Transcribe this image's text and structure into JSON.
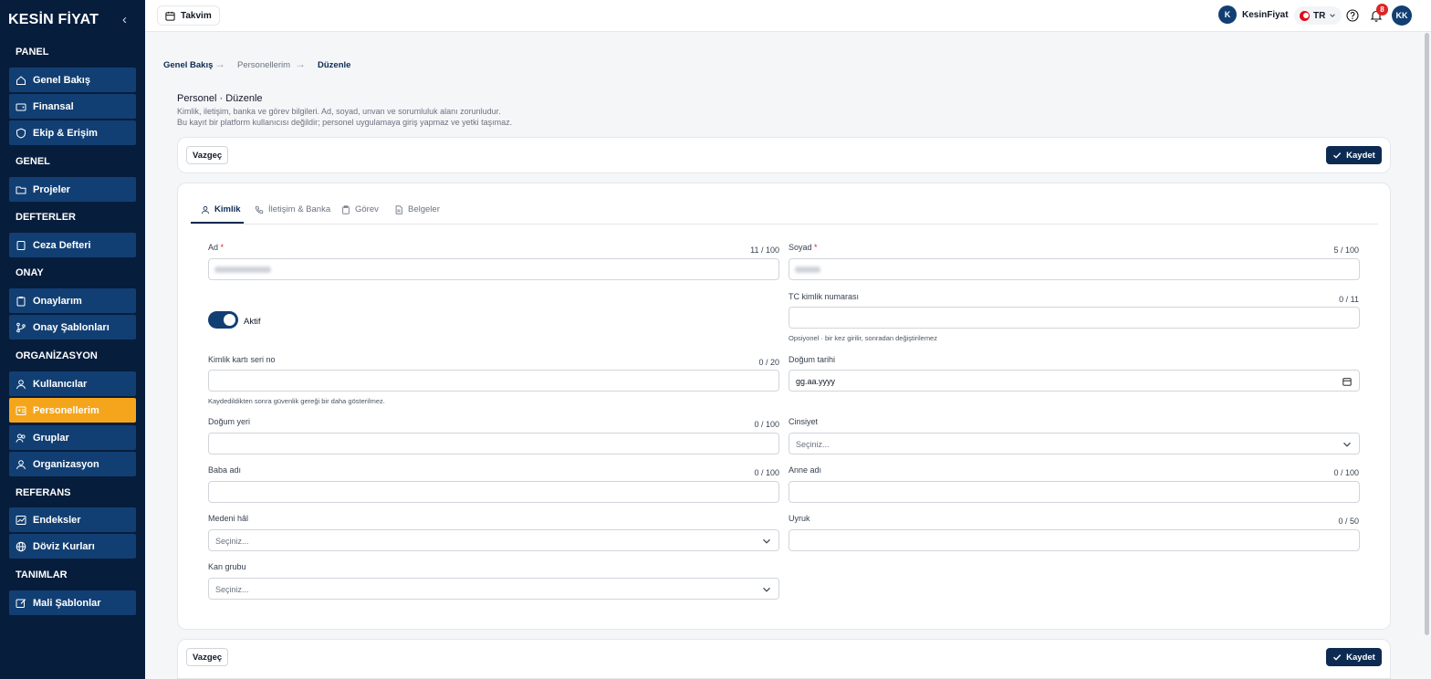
{
  "sidebar": {
    "logo": "KESİN FİYAT",
    "sections": {
      "panel": "PANEL",
      "genel": "GENEL",
      "defterler": "DEFTERLER",
      "onay": "ONAY",
      "organizasyon": "ORGANİZASYON",
      "referans": "REFERANS",
      "tanimlar": "TANIMLAR"
    },
    "items": [
      {
        "label": "Genel Bakış",
        "icon": "home-icon"
      },
      {
        "label": "Finansal",
        "icon": "wallet-icon"
      },
      {
        "label": "Ekip & Erişim",
        "icon": "shield-user-icon"
      },
      {
        "label": "Projeler",
        "icon": "folder-icon"
      },
      {
        "label": "Ceza Defteri",
        "icon": "book-icon"
      },
      {
        "label": "Onaylarım",
        "icon": "clipboard-icon"
      },
      {
        "label": "Onay Şablonları",
        "icon": "branch-icon"
      },
      {
        "label": "Kullanıcılar",
        "icon": "user-icon"
      },
      {
        "label": "Personellerim",
        "icon": "id-card-icon",
        "active": true
      },
      {
        "label": "Gruplar",
        "icon": "users-icon"
      },
      {
        "label": "Organizasyon",
        "icon": "org-icon"
      },
      {
        "label": "Endeksler",
        "icon": "chart-icon"
      },
      {
        "label": "Döviz Kurları",
        "icon": "globe-icon"
      },
      {
        "label": "Mali Şablonlar",
        "icon": "edit-icon"
      }
    ]
  },
  "header": {
    "calendar_label": "Takvim",
    "account_initial": "K",
    "account_name": "KesinFiyat",
    "language": "TR",
    "notification_count": "8",
    "user_initials": "KK"
  },
  "breadcrumb": [
    "Genel Bakış",
    "Personellerim",
    "Düzenle"
  ],
  "page": {
    "title": "Personel · Düzenle",
    "desc1": "Kimlik, iletişim, banka ve görev bilgileri. Ad, soyad, unvan ve sorumluluk alanı zorunludur.",
    "desc2": "Bu kayıt bir platform kullanıcısı değildir; personel uygulamaya giriş yapmaz ve yetki taşımaz."
  },
  "actions": {
    "cancel": "Vazgeç",
    "save": "Kaydet"
  },
  "tabs": [
    "Kimlik",
    "İletişim & Banka",
    "Görev",
    "Belgeler"
  ],
  "form": {
    "ad": {
      "label": "Ad",
      "counter": "11 / 100"
    },
    "soyad": {
      "label": "Soyad",
      "counter": "5 / 100"
    },
    "aktif": {
      "label": "Aktif",
      "on": true
    },
    "tc": {
      "label": "TC kimlik numarası",
      "counter": "0 / 11",
      "hint": "Opsiyonel · bir kez girilir, sonradan değiştirilemez"
    },
    "seri": {
      "label": "Kimlik kartı seri no",
      "counter": "0 / 20",
      "hint": "Kaydedildikten sonra güvenlik gereği bir daha gösterilmez."
    },
    "dogum_tarihi": {
      "label": "Doğum tarihi",
      "placeholder": "gg.aa.yyyy"
    },
    "dogum_yeri": {
      "label": "Doğum yeri",
      "counter": "0 / 100"
    },
    "cinsiyet": {
      "label": "Cinsiyet",
      "placeholder": "Seçiniz..."
    },
    "baba": {
      "label": "Baba adı",
      "counter": "0 / 100"
    },
    "anne": {
      "label": "Anne adı",
      "counter": "0 / 100"
    },
    "medeni": {
      "label": "Medeni hâl",
      "placeholder": "Seçiniz..."
    },
    "uyruk": {
      "label": "Uyruk",
      "counter": "0 / 50"
    },
    "kan": {
      "label": "Kan grubu",
      "placeholder": "Seçiniz..."
    }
  }
}
